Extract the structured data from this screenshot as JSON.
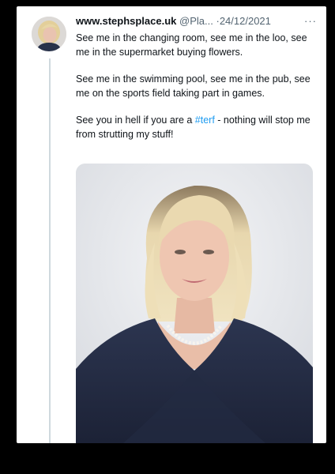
{
  "tweet": {
    "display_name": "www.stephsplace.uk",
    "handle": "@Pla...",
    "separator": "·",
    "date": "24/12/2021",
    "more_label": "···",
    "paragraphs": [
      "See me in the changing room, see me in the loo, see me in the supermarket buying flowers.",
      "See me in the swimming pool, see me in the pub, see me on the sports field taking part in games."
    ],
    "last_paragraph_before": "See you in hell if you are a ",
    "hashtag": "#terf",
    "last_paragraph_after": " - nothing will stop me from strutting my stuff!"
  },
  "colors": {
    "background": "#000000",
    "card": "#ffffff",
    "text": "#0f1419",
    "secondary": "#536471",
    "link": "#1d9bf0"
  }
}
